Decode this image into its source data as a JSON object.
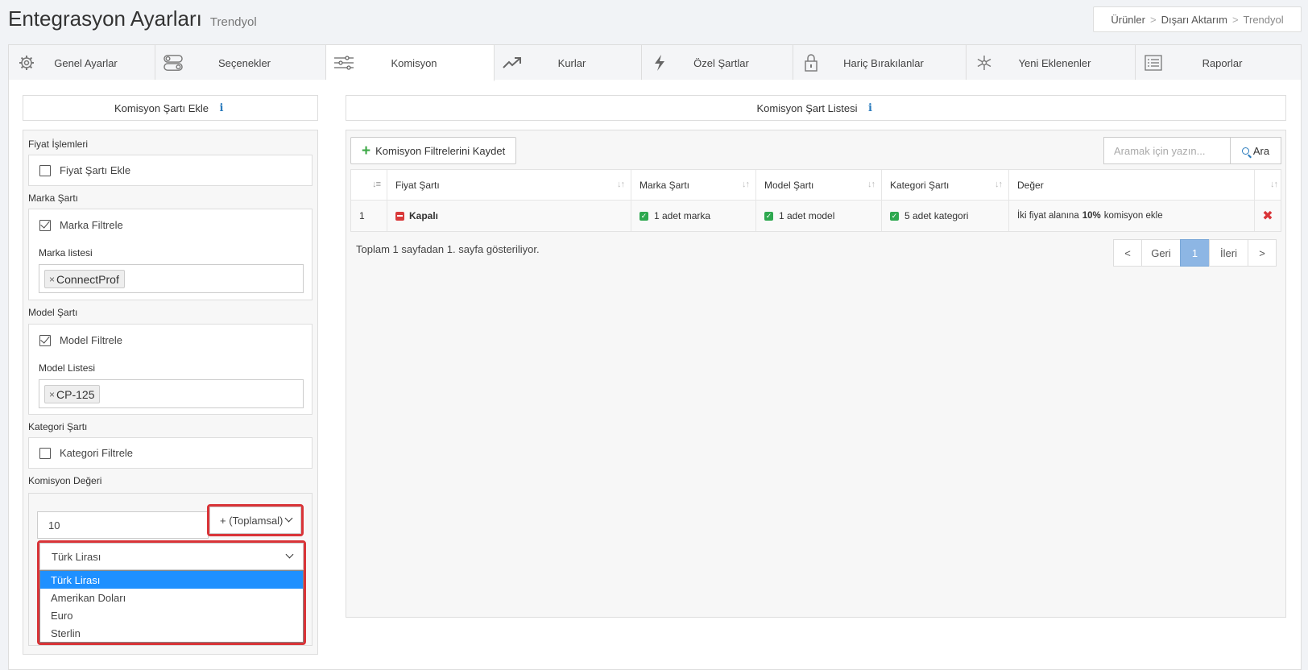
{
  "header": {
    "title": "Entegrasyon Ayarları",
    "subtitle": "Trendyol"
  },
  "breadcrumb": {
    "items": [
      "Ürünler",
      "Dışarı Aktarım",
      "Trendyol"
    ],
    "separator": ">"
  },
  "tabs": [
    {
      "label": "Genel Ayarlar",
      "icon": "gear-icon"
    },
    {
      "label": "Seçenekler",
      "icon": "toggles-icon"
    },
    {
      "label": "Komisyon",
      "icon": "sliders-icon",
      "active": true
    },
    {
      "label": "Kurlar",
      "icon": "trend-up-icon"
    },
    {
      "label": "Özel Şartlar",
      "icon": "lightning-icon"
    },
    {
      "label": "Hariç Bırakılanlar",
      "icon": "lock-icon"
    },
    {
      "label": "Yeni Eklenenler",
      "icon": "asterisk-icon"
    },
    {
      "label": "Raporlar",
      "icon": "list-icon"
    }
  ],
  "left": {
    "heading": "Komisyon Şartı Ekle",
    "fiyat": {
      "label": "Fiyat İşlemleri",
      "checkbox": "Fiyat Şartı Ekle",
      "checked": false
    },
    "marka": {
      "label": "Marka Şartı",
      "checkbox": "Marka Filtrele",
      "checked": true,
      "list_label": "Marka listesi",
      "tag": "ConnectProf",
      "tag_remove": "×"
    },
    "model": {
      "label": "Model Şartı",
      "checkbox": "Model Filtrele",
      "checked": true,
      "list_label": "Model Listesi",
      "tag": "CP-125",
      "tag_remove": "×"
    },
    "kategori": {
      "label": "Kategori Şartı",
      "checkbox": "Kategori Filtrele",
      "checked": false
    },
    "komisyon": {
      "label": "Komisyon Değeri",
      "value": "10",
      "operation": "+ (Toplamsal)",
      "currency": "Türk Lirası",
      "currency_options": [
        "Türk Lirası",
        "Amerikan Doları",
        "Euro",
        "Sterlin"
      ],
      "selected_option": "Türk Lirası"
    }
  },
  "right": {
    "heading": "Komisyon Şart Listesi",
    "save_button": "Komisyon Filtrelerini Kaydet",
    "search_placeholder": "Aramak için yazın...",
    "search_button": "Ara",
    "columns": [
      "",
      "Fiyat Şartı",
      "Marka Şartı",
      "Model Şartı",
      "Kategori Şartı",
      "Değer",
      ""
    ],
    "rows": [
      {
        "no": "1",
        "fiyat": "Kapalı",
        "marka": "1 adet marka",
        "model": "1 adet model",
        "kategori": "5 adet kategori",
        "deger_pre": "İki fiyat alanına",
        "deger_bold": "10%",
        "deger_post": "komisyon ekle",
        "delete": "✖"
      }
    ],
    "summary": "Toplam 1 sayfadan 1. sayfa gösteriliyor.",
    "pager": {
      "first": "<",
      "prev": "Geri",
      "current": "1",
      "next": "İleri",
      "last": ">"
    }
  },
  "colors": {
    "accent": "#1e90ff",
    "highlight": "#d93438",
    "success": "#2ea84f",
    "info": "#2a7bbd"
  }
}
